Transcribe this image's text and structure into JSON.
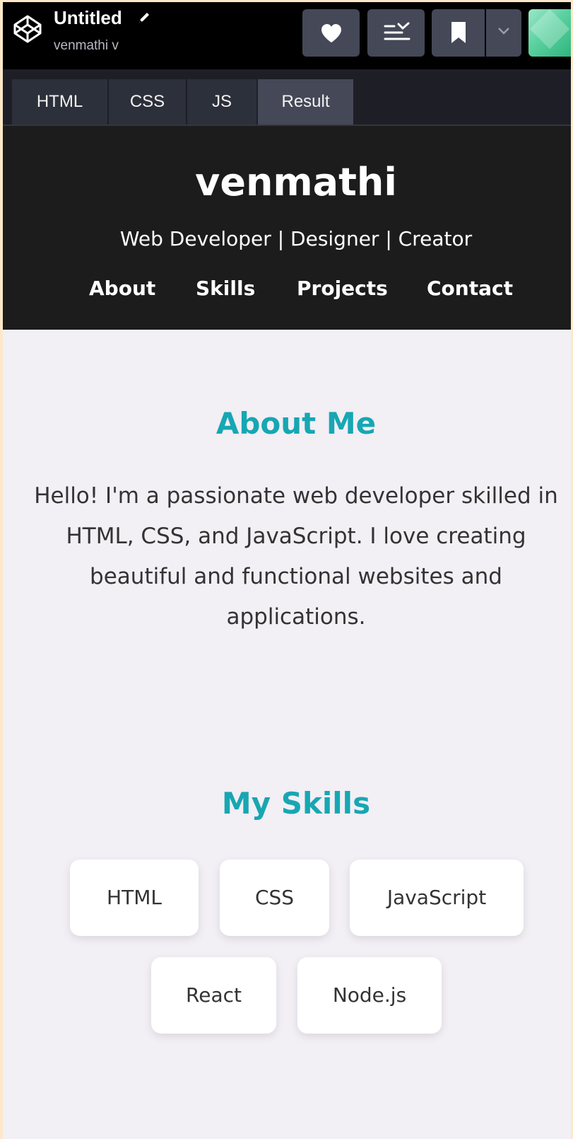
{
  "codepen": {
    "pen_title": "Untitled",
    "pen_user": "venmathi v",
    "icons": {
      "logo": "codepen-logo-icon",
      "edit": "pencil-icon",
      "like": "heart-icon",
      "view": "layout-menu-icon",
      "save": "bookmark-icon",
      "dropdown": "chevron-down-icon"
    },
    "tabs": [
      {
        "label": "HTML"
      },
      {
        "label": "CSS"
      },
      {
        "label": "JS"
      },
      {
        "label": "Result",
        "active": true
      }
    ]
  },
  "site": {
    "name": "venmathi",
    "tagline": "Web Developer | Designer | Creator",
    "nav": [
      "About",
      "Skills",
      "Projects",
      "Contact"
    ],
    "about": {
      "title": "About Me",
      "text": "Hello! I'm a passionate web developer skilled in HTML, CSS, and JavaScript. I love creating beautiful and functional websites and applications."
    },
    "skills": {
      "title": "My Skills",
      "items": [
        "HTML",
        "CSS",
        "JavaScript",
        "React",
        "Node.js"
      ]
    }
  },
  "colors": {
    "accent": "#17a7b2",
    "header_bg": "#1c1c1c",
    "page_bg": "#f2eff5",
    "codepen_bar": "#000000",
    "button_bg": "#444857"
  }
}
